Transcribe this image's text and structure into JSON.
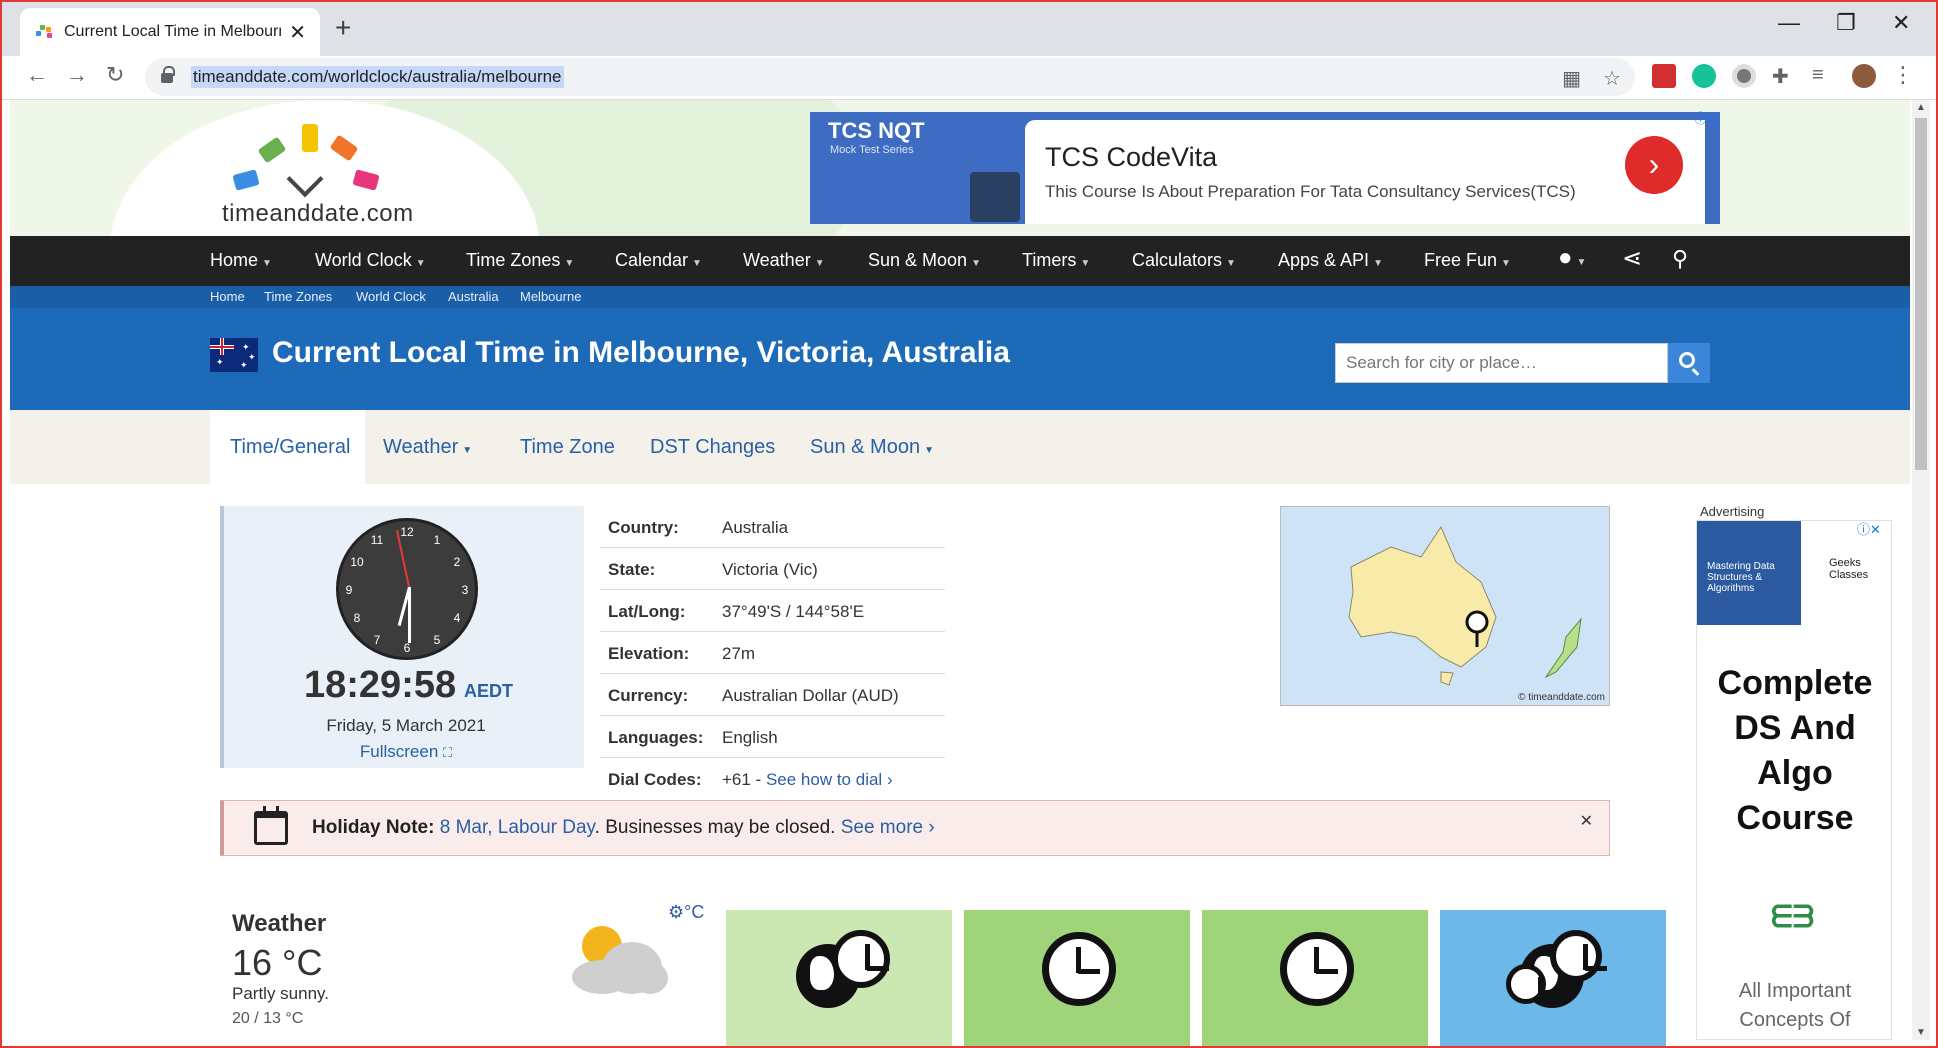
{
  "browser": {
    "tab_title": "Current Local Time in Melbourne",
    "url": "timeanddate.com/worldclock/australia/melbourne"
  },
  "site": {
    "logo_text": "timeanddate.com"
  },
  "banner_ad": {
    "brand": "TCS NQT",
    "brand_sub": "Mock Test Series",
    "headline": "TCS CodeVita",
    "text": "This Course Is About Preparation For Tata Consultancy Services(TCS)"
  },
  "nav": {
    "items": [
      "Home",
      "World Clock",
      "Time Zones",
      "Calendar",
      "Weather",
      "Sun & Moon",
      "Timers",
      "Calculators",
      "Apps & API",
      "Free Fun"
    ]
  },
  "breadcrumb": [
    "Home",
    "Time Zones",
    "World Clock",
    "Australia",
    "Melbourne"
  ],
  "page": {
    "title": "Current Local Time in Melbourne, Victoria, Australia",
    "search_placeholder": "Search for city or place…"
  },
  "subnav": [
    "Time/General",
    "Weather",
    "Time Zone",
    "DST Changes",
    "Sun & Moon"
  ],
  "clock": {
    "time": "18:29:58",
    "tz": "AEDT",
    "date": "Friday, 5 March 2021",
    "fullscreen": "Fullscreen",
    "numbers": [
      "12",
      "1",
      "2",
      "3",
      "4",
      "5",
      "6",
      "7",
      "8",
      "9",
      "10",
      "11"
    ]
  },
  "info": {
    "country_label": "Country:",
    "country": "Australia",
    "state_label": "State:",
    "state": "Victoria (Vic)",
    "latlong_label": "Lat/Long:",
    "latlong": "37°49'S / 144°58'E",
    "elevation_label": "Elevation:",
    "elevation": "27m",
    "currency_label": "Currency:",
    "currency": "Australian Dollar (AUD)",
    "languages_label": "Languages:",
    "languages": "English",
    "dial_label": "Dial Codes:",
    "dial": "+61 - ",
    "dial_link": "See how to dial"
  },
  "map": {
    "copyright": "© timeanddate.com"
  },
  "side_ad": {
    "label": "Advertising",
    "banner": "Mastering Data Structures & Algorithms",
    "brand": "Geeks Classes",
    "title": "Complete DS And Algo Course",
    "sub": "All Important Concepts Of"
  },
  "holiday": {
    "label": "Holiday Note:",
    "link": "8 Mar, Labour Day",
    "text": ". Businesses may be closed. ",
    "more": "See more"
  },
  "weather": {
    "title": "Weather",
    "temp": "16 °C",
    "desc": "Partly sunny.",
    "range": "20 / 13 °C",
    "unit": "°C"
  },
  "colors": {
    "accent": "#1d6ab8",
    "nav_bg": "#222222",
    "tile_green": "#cce8b2",
    "tile_green2": "#9fd47a",
    "tile_blue": "#6cb8e8"
  }
}
